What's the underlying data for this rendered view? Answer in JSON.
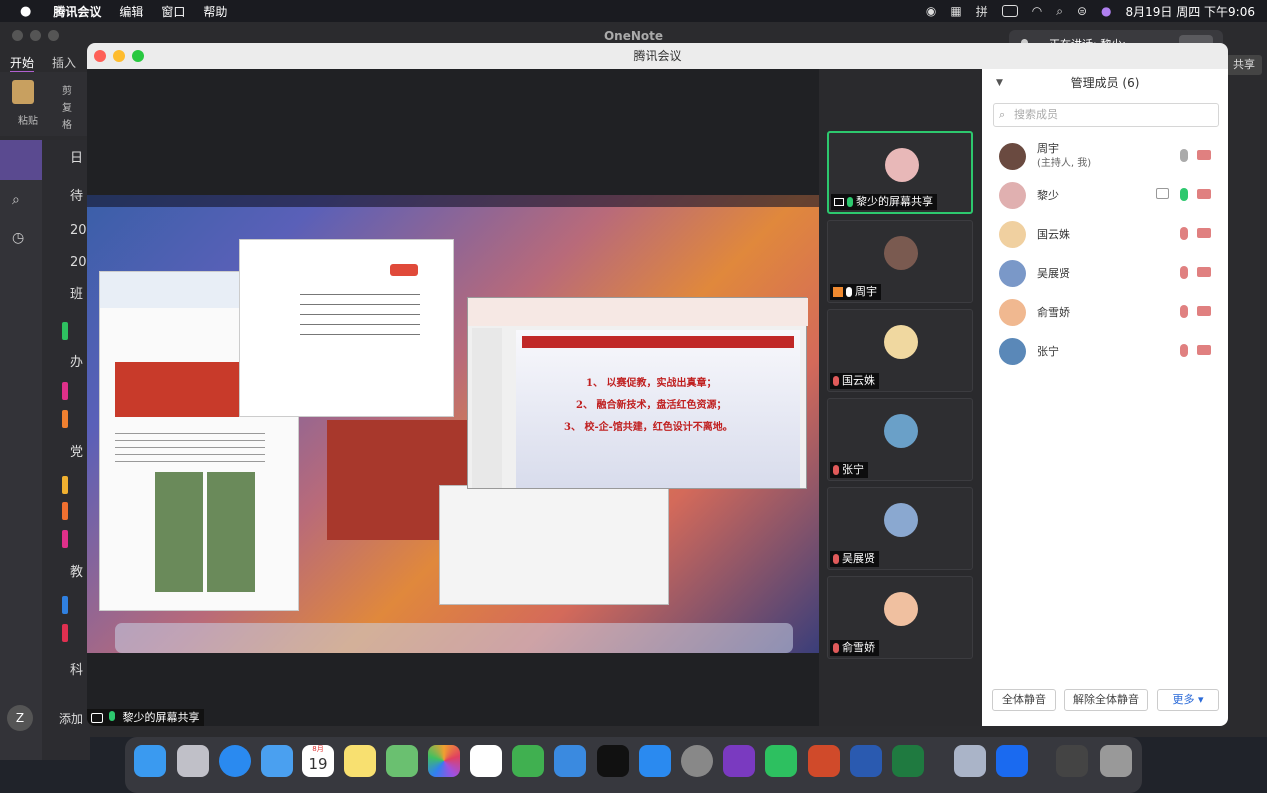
{
  "menubar": {
    "app": "腾讯会议",
    "items": [
      "编辑",
      "窗口",
      "帮助"
    ],
    "datetime": "8月19日 周四 下午9:06"
  },
  "onenote": {
    "title": "OneNote",
    "tabs": [
      "开始",
      "插入"
    ],
    "paste": "粘贴",
    "ribbon_items": [
      "剪",
      "复",
      "格"
    ],
    "nav_items": [
      "日",
      "待",
      "20",
      "20",
      "班",
      "办",
      "党",
      "教",
      "科"
    ],
    "add_label": "添加",
    "avatar_letter": "Z"
  },
  "notification": {
    "text": "正在讲话: 黎少;"
  },
  "share_button": "共享",
  "meeting": {
    "title": "腾讯会议",
    "share_label": "黎少的屏幕共享"
  },
  "slide": {
    "lines": [
      "1、 以赛促教，实战出真章；",
      "2、 融合新技术，盘活红色资源；",
      "3、 校-企-馆共建，红色设计不离地。"
    ]
  },
  "thumbs": [
    {
      "name": "黎少的屏幕共享",
      "active": true,
      "muted": false,
      "avatar": "#e8b8b8"
    },
    {
      "name": "周宇",
      "active": false,
      "muted": false,
      "avatar": "#7a5a50"
    },
    {
      "name": "国云姝",
      "active": false,
      "muted": true,
      "avatar": "#f0d8a0"
    },
    {
      "name": "张宁",
      "active": false,
      "muted": true,
      "avatar": "#6aa0c8"
    },
    {
      "name": "吴展贤",
      "active": false,
      "muted": true,
      "avatar": "#8aa8d0"
    },
    {
      "name": "俞雪娇",
      "active": false,
      "muted": true,
      "avatar": "#f0c0a0"
    }
  ],
  "panel": {
    "title": "管理成员 (6)",
    "search_placeholder": "搜索成员",
    "members": [
      {
        "name": "周宇",
        "sub": "(主持人, 我)",
        "mic": "on",
        "sharing": false,
        "avatar": "#6a4a40"
      },
      {
        "name": "黎少",
        "sub": "",
        "mic": "active",
        "sharing": true,
        "avatar": "#e0b0b0"
      },
      {
        "name": "国云姝",
        "sub": "",
        "mic": "muted",
        "sharing": false,
        "avatar": "#f0d0a0"
      },
      {
        "name": "吴展贤",
        "sub": "",
        "mic": "muted",
        "sharing": false,
        "avatar": "#7a98c8"
      },
      {
        "name": "俞雪娇",
        "sub": "",
        "mic": "muted",
        "sharing": false,
        "avatar": "#f0b890"
      },
      {
        "name": "张宁",
        "sub": "",
        "mic": "muted",
        "sharing": false,
        "avatar": "#5a88b8"
      }
    ],
    "buttons": [
      "全体静音",
      "解除全体静音",
      "更多 ▾"
    ]
  },
  "calendar": {
    "month": "8月",
    "day": "19"
  },
  "colors": {
    "active_border": "#2dc86e",
    "muted": "#e05a5a",
    "mic_active": "#2dc86e"
  }
}
